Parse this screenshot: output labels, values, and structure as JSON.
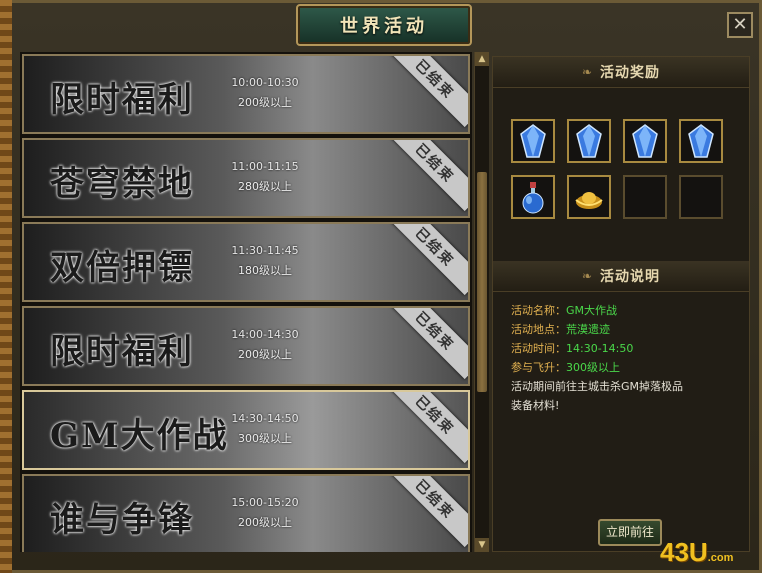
{
  "window": {
    "title": "世界活动",
    "close_label": "✕"
  },
  "activities": [
    {
      "name": "限时福利",
      "time": "10:00-10:30",
      "level": "200级以上",
      "status": "已结束"
    },
    {
      "name": "苍穹禁地",
      "time": "11:00-11:15",
      "level": "280级以上",
      "status": "已结束"
    },
    {
      "name": "双倍押镖",
      "time": "11:30-11:45",
      "level": "180级以上",
      "status": "已结束"
    },
    {
      "name": "限时福利",
      "time": "14:00-14:30",
      "level": "200级以上",
      "status": "已结束"
    },
    {
      "name": "GM大作战",
      "time": "14:30-14:50",
      "level": "300级以上",
      "status": "已结束"
    },
    {
      "name": "谁与争锋",
      "time": "15:00-15:20",
      "level": "200级以上",
      "status": "已结束"
    }
  ],
  "rewards": {
    "header": "活动奖励",
    "slots": [
      {
        "icon": "blue-crystal-icon"
      },
      {
        "icon": "blue-crystal-icon"
      },
      {
        "icon": "blue-crystal-icon"
      },
      {
        "icon": "blue-crystal-icon"
      },
      {
        "icon": "potion-bottle-icon"
      },
      {
        "icon": "gold-ingot-icon"
      },
      {
        "icon": ""
      },
      {
        "icon": ""
      }
    ]
  },
  "description": {
    "header": "活动说明",
    "name_label": "活动名称：",
    "name_value": "GM大作战",
    "place_label": "活动地点：",
    "place_value": "荒漠遗迹",
    "time_label": "活动时间：",
    "time_value": "14:30-14:50",
    "join_label": "参与飞升：",
    "join_value": "300级以上",
    "text_line1": "活动期间前往主城击杀GM掉落极品",
    "text_line2": "装备材料!"
  },
  "go_button": "立即前往",
  "scrollbar": {
    "up": "▲",
    "down": "▼"
  },
  "watermark": {
    "main": "43U",
    "suffix": ".com"
  },
  "colors": {
    "accent_gold": "#a88a40",
    "label_orange": "#e0b050",
    "value_green": "#4ad84a"
  }
}
